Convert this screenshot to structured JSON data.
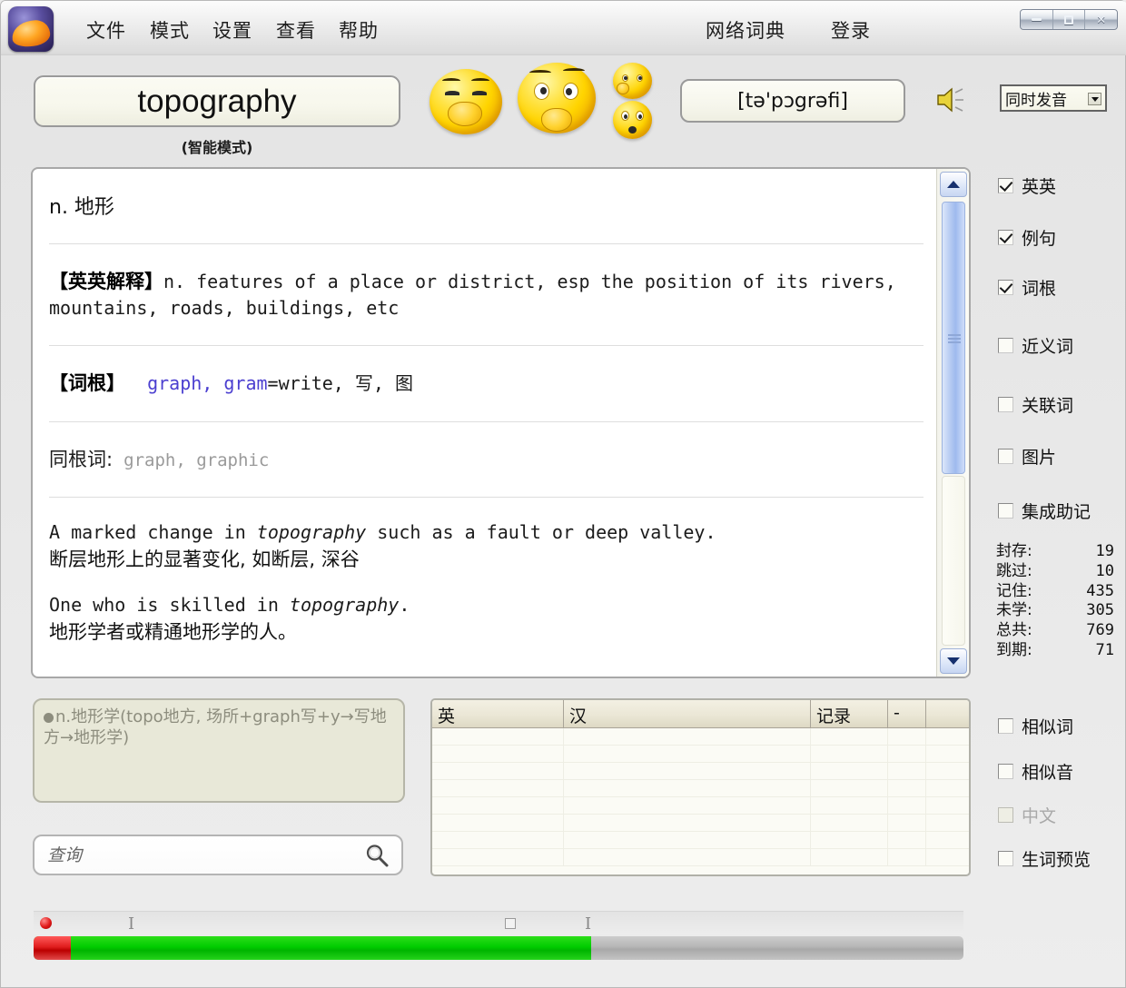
{
  "app": {
    "logo_icon": "app-logo-icon"
  },
  "menu": {
    "left_items": [
      {
        "label": "文件"
      },
      {
        "label": "模式"
      },
      {
        "label": "设置"
      },
      {
        "label": "查看"
      },
      {
        "label": "帮助"
      }
    ],
    "right_items": [
      {
        "label": "网络词典"
      },
      {
        "label": "登录"
      }
    ]
  },
  "window_controls": {
    "minimize": "minimize-icon",
    "maximize": "maximize-icon",
    "close_label": "✕"
  },
  "header": {
    "word": "topography",
    "mode_label": "(智能模式)",
    "phonetic": "[tə'pɔgrəfi]",
    "speaker_icon": "speaker-icon",
    "pronounce_mode": "同时发音",
    "smileys": [
      {
        "name": "smiley-giggle"
      },
      {
        "name": "smiley-thinking"
      },
      {
        "name": "smiley-small-wave"
      },
      {
        "name": "smiley-small-shocked"
      }
    ]
  },
  "content": {
    "definition": "n. 地形",
    "english_def_label": "【英英解释】",
    "english_def_text": "n. features of a place or district, esp the position of its rivers, mountains, roads, buildings, etc",
    "root_label": "【词根】",
    "root_words": "graph, gram",
    "root_meaning": "=write, 写, 图",
    "cognate_label": "同根词:",
    "cognate_words": "graph, graphic",
    "examples": [
      {
        "en_prefix": "A marked change in ",
        "en_word": "topography",
        "en_suffix": " such as a fault or deep valley.",
        "cn": "断层地形上的显著变化, 如断层, 深谷"
      },
      {
        "en_prefix": "One who is skilled in ",
        "en_word": "topography",
        "en_suffix": ".",
        "cn": "地形学者或精通地形学的人。"
      }
    ]
  },
  "sidebar": {
    "checkboxes_top": [
      {
        "label": "英英",
        "checked": true
      },
      {
        "label": "例句",
        "checked": true
      },
      {
        "label": "词根",
        "checked": true
      },
      {
        "label": "近义词",
        "checked": false
      },
      {
        "label": "关联词",
        "checked": false
      },
      {
        "label": "图片",
        "checked": false
      },
      {
        "label": "集成助记",
        "checked": false
      }
    ],
    "stats": [
      {
        "label": "封存:",
        "value": "19"
      },
      {
        "label": "跳过:",
        "value": "10"
      },
      {
        "label": "记住:",
        "value": "435"
      },
      {
        "label": "未学:",
        "value": "305"
      },
      {
        "label": "总共:",
        "value": "769"
      },
      {
        "label": "到期:",
        "value": "71"
      }
    ],
    "checkboxes_bottom": [
      {
        "label": "相似词",
        "checked": false,
        "disabled": false
      },
      {
        "label": "相似音",
        "checked": false,
        "disabled": false
      },
      {
        "label": "中文",
        "checked": false,
        "disabled": true
      },
      {
        "label": "生词预览",
        "checked": false,
        "disabled": false
      }
    ]
  },
  "mnemonic": {
    "text": "n.地形学(topo地方, 场所+graph写+y→写地方→地形学)"
  },
  "search": {
    "placeholder": "查询",
    "value": "",
    "icon": "search-icon"
  },
  "table": {
    "headers": [
      "英",
      "汉",
      "记录",
      "-",
      ""
    ],
    "rows": []
  },
  "progress": {
    "percent": 60,
    "red_percent": 4,
    "markers": [
      {
        "type": "i",
        "position_pct": 10
      },
      {
        "type": "square",
        "position_pct": 51
      },
      {
        "type": "i",
        "position_pct": 59
      }
    ],
    "dot_color": "#e01818",
    "fill_color": "#00cc00"
  }
}
